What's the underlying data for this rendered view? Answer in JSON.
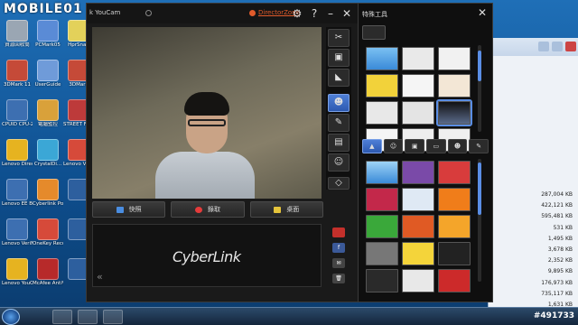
{
  "watermark": "MOBILE01",
  "desktop_icons": [
    {
      "label": "資源回收筒"
    },
    {
      "label": "PCMark05"
    },
    {
      "label": "HprSnap"
    },
    {
      "label": "3DMark 11"
    },
    {
      "label": "UserGuide"
    },
    {
      "label": "3DMark"
    },
    {
      "label": "CPUID CPU-Z"
    },
    {
      "label": "電腦監控"
    },
    {
      "label": "STREET FIGHTER"
    },
    {
      "label": "Lenovo DirectShare"
    },
    {
      "label": "CrystalDi..."
    },
    {
      "label": "Lenovo Vantag"
    },
    {
      "label": "Lenovo EE Boot Op..."
    },
    {
      "label": "Cyberlink Power2Go"
    },
    {
      "label": ""
    },
    {
      "label": "Lenovo VeriFace 4.0"
    },
    {
      "label": "OneKey Recovery"
    },
    {
      "label": ""
    },
    {
      "label": "Lenovo YouCam"
    },
    {
      "label": "McAfee AntiVir..."
    },
    {
      "label": ""
    }
  ],
  "youcam": {
    "title": "k YouCam",
    "director_zone": "DirectorZone",
    "buttons": {
      "capture": "快照",
      "record": "錄取",
      "desktop": "桌面"
    },
    "logo": "CyberLink",
    "share": {
      "youtube": "YouTube",
      "facebook": "f"
    }
  },
  "effects": {
    "title": "特殊工具"
  },
  "explorer_sizes": [
    "287,004 KB",
    "422,121 KB",
    "595,481 KB",
    "531 KB",
    "1,495 KB",
    "3,678 KB",
    "2,352 KB",
    "9,895 KB",
    "176,973 KB",
    "735,117 KB",
    "1,631 KB",
    "1 KB",
    "1,182 KB"
  ],
  "tray": {
    "text": "#491733"
  },
  "colors": {
    "accent": "#5a8ee5",
    "director": "#e15b2b",
    "record": "#e53b3b"
  }
}
